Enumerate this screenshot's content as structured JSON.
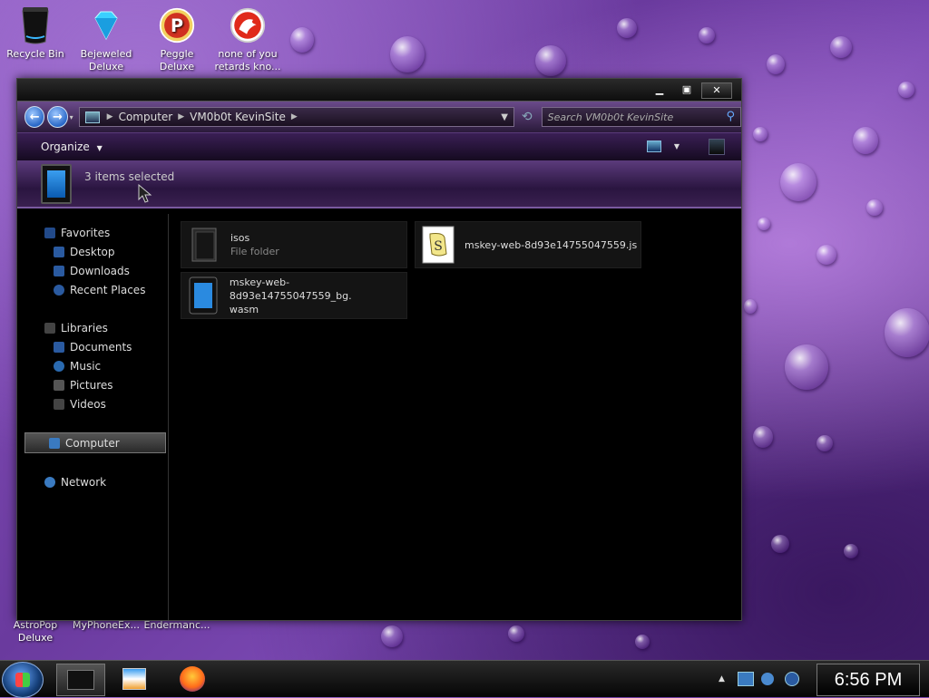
{
  "desktop": {
    "icons": [
      {
        "label": "Recycle Bin"
      },
      {
        "label": "Bejeweled Deluxe"
      },
      {
        "label": "Peggle Deluxe"
      },
      {
        "label": "none of you retards kno..."
      },
      {
        "label": "AstroPop Deluxe"
      },
      {
        "label": "MyPhoneEx..."
      },
      {
        "label": "Endermanc..."
      }
    ],
    "wallpaper_colors": {
      "primary": "#7a48b2",
      "dark": "#3a1860",
      "light": "#b07ad8"
    }
  },
  "window": {
    "controls": {
      "minimize": "▁",
      "maximize": "▣",
      "close": "✕"
    },
    "address": {
      "crumbs": [
        "Computer",
        "VM0b0t KevinSite"
      ]
    },
    "search": {
      "placeholder": "Search VM0b0t KevinSite"
    },
    "toolbar": {
      "organize_label": "Organize"
    },
    "details": {
      "status": "3 items selected"
    },
    "sidebar": {
      "favorites": {
        "header": "Favorites",
        "items": [
          "Desktop",
          "Downloads",
          "Recent Places"
        ]
      },
      "libraries": {
        "header": "Libraries",
        "items": [
          "Documents",
          "Music",
          "Pictures",
          "Videos"
        ]
      },
      "computer": "Computer",
      "network": "Network"
    },
    "files": [
      {
        "name": "isos",
        "type": "File folder",
        "icon": "folder-icon"
      },
      {
        "name": "mskey-web-8d93e14755047559.js",
        "type": "",
        "icon": "script-file-icon"
      },
      {
        "name": "mskey-web-8d93e14755047559_bg.",
        "name2": "wasm",
        "type": "",
        "icon": "blank-file-icon"
      }
    ]
  },
  "taskbar": {
    "clock": "6:56 PM",
    "items": [
      "explorer-icon",
      "media-player-icon",
      "firefox-icon"
    ]
  },
  "accent": {
    "brand_purple": "#5a3a7a",
    "nav_blue": "#2a68c8"
  }
}
